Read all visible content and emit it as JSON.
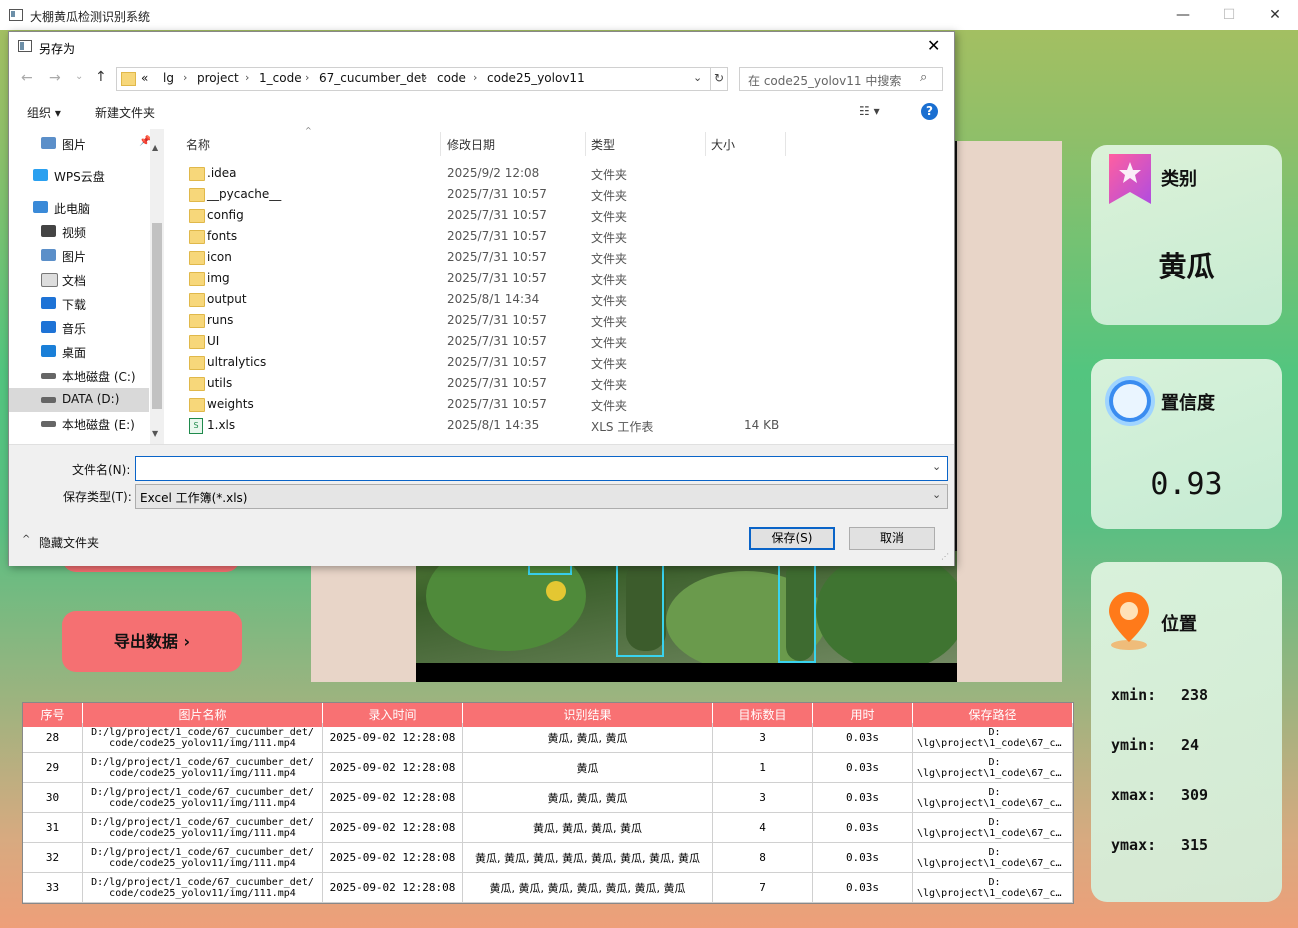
{
  "app": {
    "title": "大棚黄瓜检测识别系统",
    "minimize": "—",
    "maximize": "☐",
    "close": "✕"
  },
  "cards": {
    "category": {
      "title": "类别",
      "value": "黄瓜"
    },
    "confidence": {
      "title": "置信度",
      "value": "0.93"
    },
    "position": {
      "title": "位置",
      "rows": [
        {
          "label": "xmin:",
          "value": "238"
        },
        {
          "label": "ymin:",
          "value": "24"
        },
        {
          "label": "xmax:",
          "value": "309"
        },
        {
          "label": "ymax:",
          "value": "315"
        }
      ]
    }
  },
  "buttons": {
    "export": "导出数据 ›"
  },
  "table": {
    "headers": [
      "序号",
      "图片名称",
      "录入时间",
      "识别结果",
      "目标数目",
      "用时",
      "保存路径"
    ],
    "rows": [
      {
        "id": "28",
        "name1": "D:/lg/project/1_code/67_cucumber_det/",
        "name2": "code/code25_yolov11/img/111.mp4",
        "time": "2025-09-02 12:28:08",
        "result": "黄瓜, 黄瓜, 黄瓜",
        "count": "3",
        "dur": "0.03s",
        "path1": "D:",
        "path2": "\\lg\\project\\1_code\\67_c…"
      },
      {
        "id": "29",
        "name1": "D:/lg/project/1_code/67_cucumber_det/",
        "name2": "code/code25_yolov11/img/111.mp4",
        "time": "2025-09-02 12:28:08",
        "result": "黄瓜",
        "count": "1",
        "dur": "0.03s",
        "path1": "D:",
        "path2": "\\lg\\project\\1_code\\67_c…"
      },
      {
        "id": "30",
        "name1": "D:/lg/project/1_code/67_cucumber_det/",
        "name2": "code/code25_yolov11/img/111.mp4",
        "time": "2025-09-02 12:28:08",
        "result": "黄瓜, 黄瓜, 黄瓜",
        "count": "3",
        "dur": "0.03s",
        "path1": "D:",
        "path2": "\\lg\\project\\1_code\\67_c…"
      },
      {
        "id": "31",
        "name1": "D:/lg/project/1_code/67_cucumber_det/",
        "name2": "code/code25_yolov11/img/111.mp4",
        "time": "2025-09-02 12:28:08",
        "result": "黄瓜, 黄瓜, 黄瓜, 黄瓜",
        "count": "4",
        "dur": "0.03s",
        "path1": "D:",
        "path2": "\\lg\\project\\1_code\\67_c…"
      },
      {
        "id": "32",
        "name1": "D:/lg/project/1_code/67_cucumber_det/",
        "name2": "code/code25_yolov11/img/111.mp4",
        "time": "2025-09-02 12:28:08",
        "result": "黄瓜, 黄瓜, 黄瓜, 黄瓜, 黄瓜, 黄瓜, 黄瓜, 黄瓜",
        "count": "8",
        "dur": "0.03s",
        "path1": "D:",
        "path2": "\\lg\\project\\1_code\\67_c…"
      },
      {
        "id": "33",
        "name1": "D:/lg/project/1_code/67_cucumber_det/",
        "name2": "code/code25_yolov11/img/111.mp4",
        "time": "2025-09-02 12:28:08",
        "result": "黄瓜, 黄瓜, 黄瓜, 黄瓜, 黄瓜, 黄瓜, 黄瓜",
        "count": "7",
        "dur": "0.03s",
        "path1": "D:",
        "path2": "\\lg\\project\\1_code\\67_c…"
      }
    ]
  },
  "dialog": {
    "title": "另存为",
    "close": "✕",
    "breadcrumbs": [
      "«",
      "lg",
      "project",
      "1_code",
      "67_cucumber_det",
      "code",
      "code25_yolov11"
    ],
    "search_placeholder": "在 code25_yolov11 中搜索",
    "toolbar": {
      "organize": "组织 ▾",
      "new_folder": "新建文件夹"
    },
    "nav": [
      {
        "label": "图片",
        "icon": "pictures-icon"
      },
      {
        "label": "WPS云盘",
        "icon": "cloud-icon"
      },
      {
        "label": "此电脑",
        "icon": "computer-icon"
      },
      {
        "label": "视频",
        "icon": "video-icon"
      },
      {
        "label": "图片",
        "icon": "pictures-icon"
      },
      {
        "label": "文档",
        "icon": "document-icon"
      },
      {
        "label": "下载",
        "icon": "download-icon"
      },
      {
        "label": "音乐",
        "icon": "music-icon"
      },
      {
        "label": "桌面",
        "icon": "desktop-icon"
      },
      {
        "label": "本地磁盘 (C:)",
        "icon": "drive-icon"
      },
      {
        "label": "DATA (D:)",
        "icon": "drive-icon"
      },
      {
        "label": "本地磁盘 (E:)",
        "icon": "drive-icon"
      }
    ],
    "columns": [
      "名称",
      "修改日期",
      "类型",
      "大小"
    ],
    "files": [
      {
        "name": ".idea",
        "date": "2025/9/2 12:08",
        "type": "文件夹",
        "size": ""
      },
      {
        "name": "__pycache__",
        "date": "2025/7/31 10:57",
        "type": "文件夹",
        "size": ""
      },
      {
        "name": "config",
        "date": "2025/7/31 10:57",
        "type": "文件夹",
        "size": ""
      },
      {
        "name": "fonts",
        "date": "2025/7/31 10:57",
        "type": "文件夹",
        "size": ""
      },
      {
        "name": "icon",
        "date": "2025/7/31 10:57",
        "type": "文件夹",
        "size": ""
      },
      {
        "name": "img",
        "date": "2025/7/31 10:57",
        "type": "文件夹",
        "size": ""
      },
      {
        "name": "output",
        "date": "2025/8/1 14:34",
        "type": "文件夹",
        "size": ""
      },
      {
        "name": "runs",
        "date": "2025/7/31 10:57",
        "type": "文件夹",
        "size": ""
      },
      {
        "name": "UI",
        "date": "2025/7/31 10:57",
        "type": "文件夹",
        "size": ""
      },
      {
        "name": "ultralytics",
        "date": "2025/7/31 10:57",
        "type": "文件夹",
        "size": ""
      },
      {
        "name": "utils",
        "date": "2025/7/31 10:57",
        "type": "文件夹",
        "size": ""
      },
      {
        "name": "weights",
        "date": "2025/7/31 10:57",
        "type": "文件夹",
        "size": ""
      },
      {
        "name": "1.xls",
        "date": "2025/8/1 14:35",
        "type": "XLS 工作表",
        "size": "14 KB"
      }
    ],
    "filename_label": "文件名(N):",
    "filename_value": "",
    "filetype_label": "保存类型(T):",
    "filetype_value": "Excel 工作簿(*.xls)",
    "hide_folders": "隐藏文件夹",
    "save": "保存(S)",
    "cancel": "取消"
  }
}
